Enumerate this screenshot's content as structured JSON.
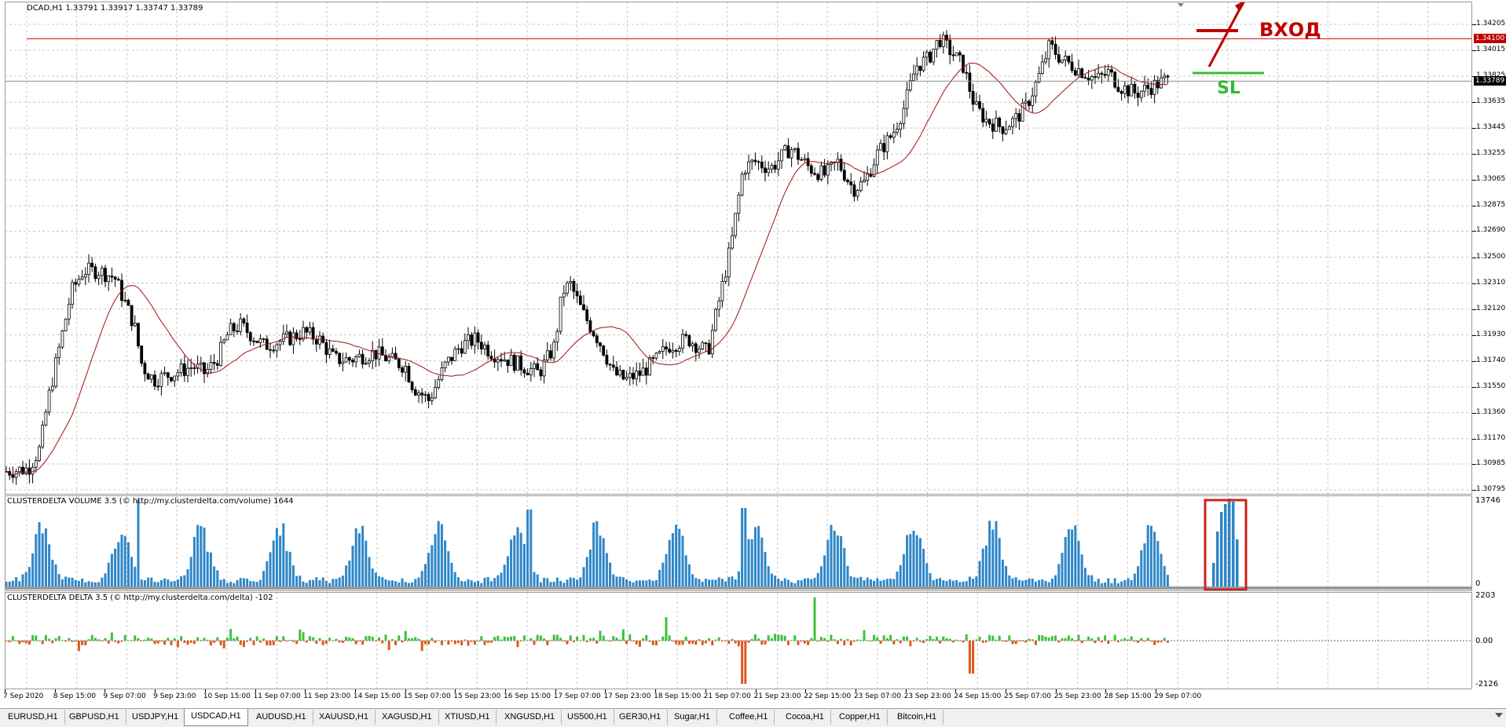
{
  "main_chart": {
    "title": "DCAD,H1  1.33791 1.33917 1.33747 1.33789",
    "price_levels": [
      "1.34205",
      "1.34015",
      "1.33825",
      "1.33635",
      "1.33445",
      "1.33255",
      "1.33065",
      "1.32875",
      "1.32690",
      "1.32500",
      "1.32310",
      "1.32120",
      "1.31930",
      "1.31740",
      "1.31550",
      "1.31360",
      "1.31170",
      "1.30985",
      "1.30795"
    ],
    "entry_line_price": "1.34100",
    "current_price": "1.33789",
    "entry_label": "ВХОД",
    "sl_label": "SL"
  },
  "volume_indicator": {
    "title": "CLUSTERDELTA VOLUME 3.5 (© http://my.clusterdelta.com/volume) 1644",
    "scale_max": "13746",
    "scale_min": "0"
  },
  "delta_indicator": {
    "title": "CLUSTERDELTA DELTA 3.5 (© http://my.clusterdelta.com/delta) -102",
    "scale_max": "2203",
    "scale_zero": "0.00",
    "scale_min": "-2126"
  },
  "time_axis": [
    "7 Sep 2020",
    "8 Sep 15:00",
    "9 Sep 07:00",
    "9 Sep 23:00",
    "10 Sep 15:00",
    "11 Sep 07:00",
    "11 Sep 23:00",
    "14 Sep 15:00",
    "15 Sep 07:00",
    "15 Sep 23:00",
    "16 Sep 15:00",
    "17 Sep 07:00",
    "17 Sep 23:00",
    "18 Sep 15:00",
    "21 Sep 07:00",
    "21 Sep 23:00",
    "22 Sep 15:00",
    "23 Sep 07:00",
    "23 Sep 23:00",
    "24 Sep 15:00",
    "25 Sep 07:00",
    "25 Sep 23:00",
    "28 Sep 15:00",
    "29 Sep 07:00"
  ],
  "tabs": [
    "EURUSD,H1",
    "GBPUSD,H1",
    "USDJPY,H1",
    "USDCAD,H1",
    "AUDUSD,H1",
    "XAUUSD,H1",
    "XAGUSD,H1",
    "XTIUSD,H1",
    "XNGUSD,H1",
    "US500,H1",
    "GER30,H1",
    "Sugar,H1",
    "Coffee,H1",
    "Cocoa,H1",
    "Copper,H1",
    "Bitcoin,H1"
  ],
  "active_tab": "USDCAD,H1",
  "colors": {
    "bull_volume": "#2e86c8",
    "positive_delta": "#3fbf3f",
    "negative_delta": "#e05a1c",
    "entry_line": "#c00000",
    "sl_line": "#33bb33",
    "moving_average": "#a01010",
    "highlight_box": "#cc2222"
  }
}
